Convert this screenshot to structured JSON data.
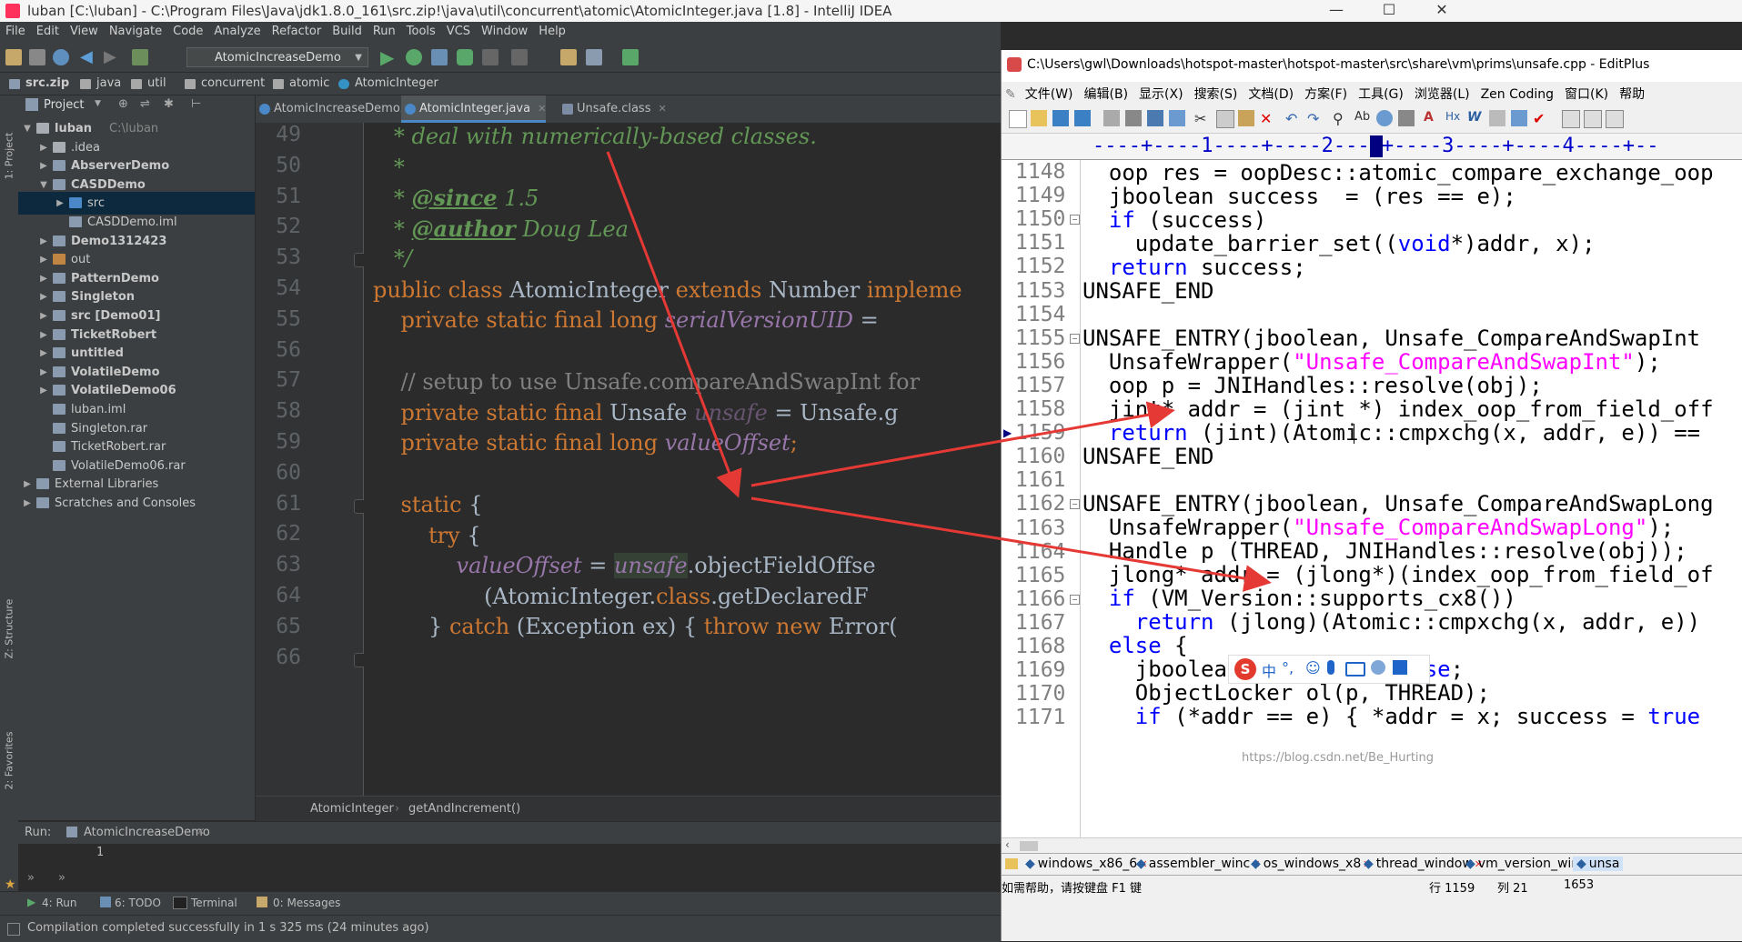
{
  "intellij": {
    "title": "luban [C:\\luban] - C:\\Program Files\\Java\\jdk1.8.0_161\\src.zip!\\java\\util\\concurrent\\atomic\\AtomicInteger.java [1.8] - IntelliJ IDEA",
    "menu": [
      "File",
      "Edit",
      "View",
      "Navigate",
      "Code",
      "Analyze",
      "Refactor",
      "Build",
      "Run",
      "Tools",
      "VCS",
      "Window",
      "Help"
    ],
    "run_config": "AtomicIncreaseDemo",
    "breadcrumbs": [
      "src.zip",
      "java",
      "util",
      "concurrent",
      "atomic",
      "AtomicInteger"
    ],
    "project_panel": {
      "title": "Project",
      "tree": [
        {
          "label": "luban",
          "sub": "C:\\luban",
          "arrow": "▼",
          "icon": "folder"
        },
        {
          "label": ".idea",
          "arrow": "▶",
          "icon": "folder"
        },
        {
          "label": "AbserverDemo",
          "arrow": "▶",
          "icon": "module"
        },
        {
          "label": "CASDDemo",
          "arrow": "▼",
          "icon": "module"
        },
        {
          "label": "src",
          "arrow": "▶",
          "icon": "src",
          "selected": true
        },
        {
          "label": "CASDDemo.iml",
          "arrow": "",
          "icon": "file"
        },
        {
          "label": "Demo1312423",
          "arrow": "▶",
          "icon": "module"
        },
        {
          "label": "out",
          "arrow": "▶",
          "icon": "out"
        },
        {
          "label": "PatternDemo",
          "arrow": "▶",
          "icon": "module"
        },
        {
          "label": "Singleton",
          "arrow": "▶",
          "icon": "module"
        },
        {
          "label": "src [Demo01]",
          "arrow": "▶",
          "icon": "module"
        },
        {
          "label": "TicketRobert",
          "arrow": "▶",
          "icon": "module"
        },
        {
          "label": "untitled",
          "arrow": "▶",
          "icon": "module"
        },
        {
          "label": "VolatileDemo",
          "arrow": "▶",
          "icon": "module"
        },
        {
          "label": "VolatileDemo06",
          "arrow": "▶",
          "icon": "module"
        },
        {
          "label": "luban.iml",
          "arrow": "",
          "icon": "file"
        },
        {
          "label": "Singleton.rar",
          "arrow": "",
          "icon": "file"
        },
        {
          "label": "TicketRobert.rar",
          "arrow": "",
          "icon": "file"
        },
        {
          "label": "VolatileDemo06.rar",
          "arrow": "",
          "icon": "file"
        },
        {
          "label": "External Libraries",
          "arrow": "▶",
          "icon": "lib"
        },
        {
          "label": "Scratches and Consoles",
          "arrow": "▶",
          "icon": "scratch"
        }
      ]
    },
    "editor_tabs": [
      {
        "label": "AtomicIncreaseDemo.java",
        "active": false
      },
      {
        "label": "AtomicInteger.java",
        "active": true
      },
      {
        "label": "Unsafe.class",
        "active": false
      }
    ],
    "line_numbers": [
      "49",
      "50",
      "51",
      "52",
      "53",
      "54",
      "55",
      "56",
      "57",
      "58",
      "59",
      "60",
      "61",
      "62",
      "63",
      "64",
      "65",
      "66"
    ],
    "editor_breadcrumb": [
      "AtomicInteger",
      "getAndIncrement()"
    ],
    "run_panel": {
      "label": "Run:",
      "config": "AtomicIncreaseDemo",
      "output": "1"
    },
    "left_strip": [
      "1: Project",
      "Z: Structure",
      "2: Favorites"
    ],
    "bottom_tabs": [
      "4: Run",
      "6: TODO",
      "Terminal",
      "0: Messages"
    ],
    "status": "Compilation completed successfully in 1 s 325 ms (24 minutes ago)"
  },
  "editplus": {
    "title": "C:\\Users\\gwl\\Downloads\\hotspot-master\\hotspot-master\\src\\share\\vm\\prims\\unsafe.cpp - EditPlus",
    "menu": [
      "文件(W)",
      "编辑(B)",
      "显示(X)",
      "搜索(S)",
      "文档(D)",
      "方案(F)",
      "工具(G)",
      "浏览器(L)",
      "Zen Coding",
      "窗口(K)",
      "帮助"
    ],
    "ruler": "----+----1----+----2----+----3----+----4----+--",
    "line_numbers": [
      "1148",
      "1149",
      "1150",
      "1151",
      "1152",
      "1153",
      "1154",
      "1155",
      "1156",
      "1157",
      "1158",
      "1159",
      "1160",
      "1161",
      "1162",
      "1163",
      "1164",
      "1165",
      "1166",
      "1167",
      "1168",
      "1169",
      "1170",
      "1171"
    ],
    "file_tabs": [
      "windows_x86_6",
      "assembler_winc",
      "os_windows_x8",
      "thread_window",
      "vm_version_win",
      "unsa"
    ],
    "status_help": "如需帮助，请按键盘 F1 键",
    "status_line": "行 1159",
    "status_col": "列 21",
    "status_num": "1653",
    "ime_label": "中"
  },
  "watermark": "https://blog.csdn.net/Be_Hurting",
  "colors": {
    "arrow": "#e53935",
    "ij_bg": "#2b2b2b",
    "ep_keyword": "#0000ff",
    "ep_string": "#ff00ff"
  }
}
